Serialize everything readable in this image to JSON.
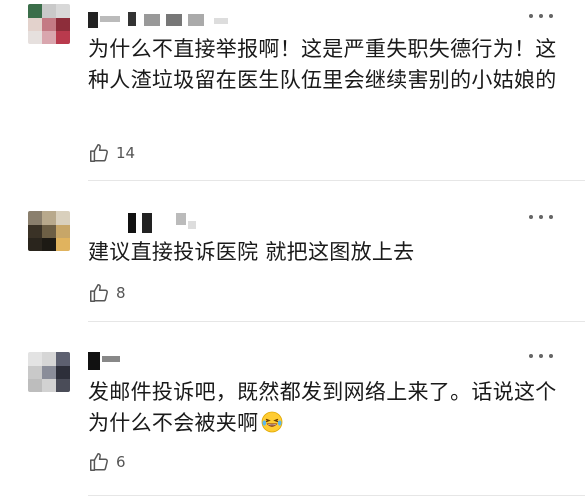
{
  "comments": [
    {
      "username": "",
      "text": "为什么不直接举报啊！这是严重失职失德行为！这种人渣垃圾留在医生队伍里会继续害别的小姑娘的",
      "likes": "14",
      "more_icon": "more-dots-icon",
      "like_icon": "thumbs-up-icon"
    },
    {
      "username": "",
      "text": "建议直接投诉医院 就把这图放上去",
      "likes": "8",
      "more_icon": "more-dots-icon",
      "like_icon": "thumbs-up-icon"
    },
    {
      "username": "",
      "text": "发邮件投诉吧，既然都发到网络上来了。话说这个为什么不会被夹啊",
      "emoji": "laughing-tears-emoji",
      "likes": "6",
      "more_icon": "more-dots-icon",
      "like_icon": "thumbs-up-icon"
    }
  ],
  "colors": {
    "text": "#1a1a1a",
    "meta": "#555555",
    "divider": "#e6e6e6"
  }
}
